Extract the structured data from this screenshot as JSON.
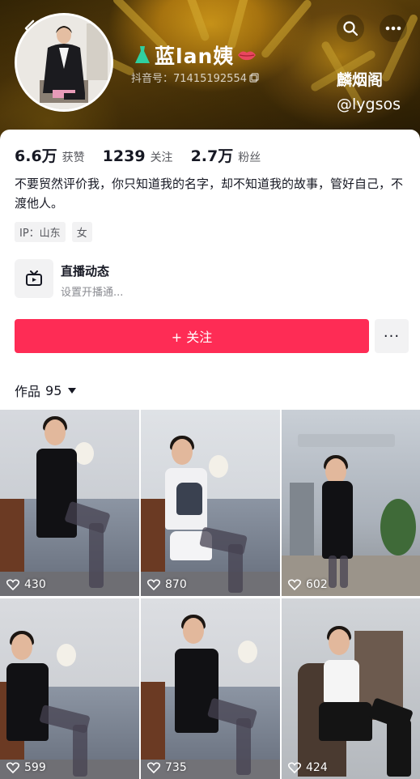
{
  "header": {
    "nickname": "蓝lan姨",
    "douyin_id": "抖音号：71415192554",
    "watermark_title": "麟烟阁",
    "watermark_handle": "@lygsos"
  },
  "stats": [
    {
      "value": "6.6万",
      "label": "获赞"
    },
    {
      "value": "1239",
      "label": "关注"
    },
    {
      "value": "2.7万",
      "label": "粉丝"
    }
  ],
  "bio": "不要贸然评价我，你只知道我的名字，却不知道我的故事，管好自己，不渡他人。",
  "tags": [
    "IP：山东",
    "女"
  ],
  "live": {
    "title": "直播动态",
    "subtitle": "设置开播通..."
  },
  "follow_button": "+ 关注",
  "more_button": "···",
  "works": {
    "label": "作品",
    "count": "95"
  },
  "videos": [
    {
      "likes": "430"
    },
    {
      "likes": "870"
    },
    {
      "likes": "602"
    },
    {
      "likes": "599"
    },
    {
      "likes": "735"
    },
    {
      "likes": "424"
    }
  ],
  "colors": {
    "accent": "#fe2c55",
    "banner": "#6e4c0c"
  },
  "icons": [
    "back-icon",
    "search-icon",
    "more-icon",
    "copy-icon",
    "tv-icon",
    "heart-icon",
    "dress-icon",
    "lips-icon"
  ]
}
